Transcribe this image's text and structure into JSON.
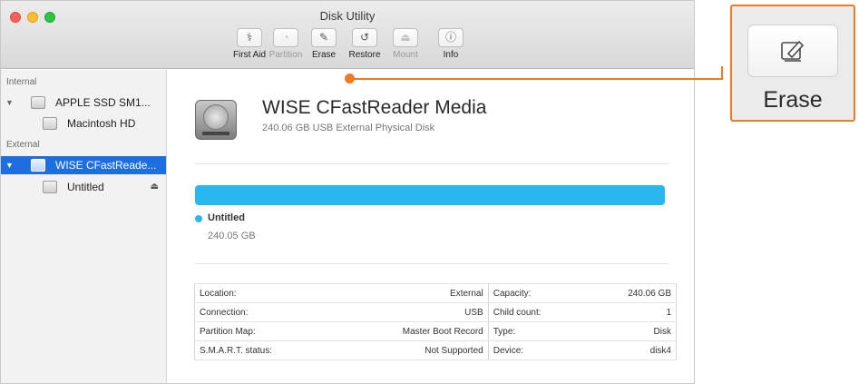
{
  "window": {
    "title": "Disk Utility"
  },
  "toolbar": {
    "first_aid": {
      "label": "First Aid",
      "icon": "stethoscope-icon"
    },
    "partition": {
      "label": "Partition",
      "icon": "pie-chart-icon"
    },
    "erase": {
      "label": "Erase",
      "icon": "eraser-icon"
    },
    "restore": {
      "label": "Restore",
      "icon": "restore-icon"
    },
    "mount": {
      "label": "Mount",
      "icon": "mount-icon"
    },
    "info": {
      "label": "Info",
      "icon": "info-icon"
    }
  },
  "sidebar": {
    "internal_header": "Internal",
    "external_header": "External",
    "items": [
      {
        "label": "APPLE SSD SM1...",
        "expand": "▼"
      },
      {
        "label": "Macintosh HD"
      },
      {
        "label": "WISE CFastReade...",
        "expand": "▼",
        "selected": true
      },
      {
        "label": "Untitled",
        "eject": "⏏"
      }
    ]
  },
  "main": {
    "disk_name": "WISE CFastReader Media",
    "disk_subtitle": "240.06 GB USB External Physical Disk",
    "volume": {
      "name": "Untitled",
      "size": "240.05 GB",
      "color": "#29b7f0"
    }
  },
  "details": {
    "rows": [
      {
        "k1": "Location:",
        "v1": "External",
        "k2": "Capacity:",
        "v2": "240.06 GB"
      },
      {
        "k1": "Connection:",
        "v1": "USB",
        "k2": "Child count:",
        "v2": "1"
      },
      {
        "k1": "Partition Map:",
        "v1": "Master Boot Record",
        "k2": "Type:",
        "v2": "Disk"
      },
      {
        "k1": "S.M.A.R.T. status:",
        "v1": "Not Supported",
        "k2": "Device:",
        "v2": "disk4"
      }
    ]
  },
  "callout": {
    "label": "Erase",
    "color": "#ef7a22"
  }
}
